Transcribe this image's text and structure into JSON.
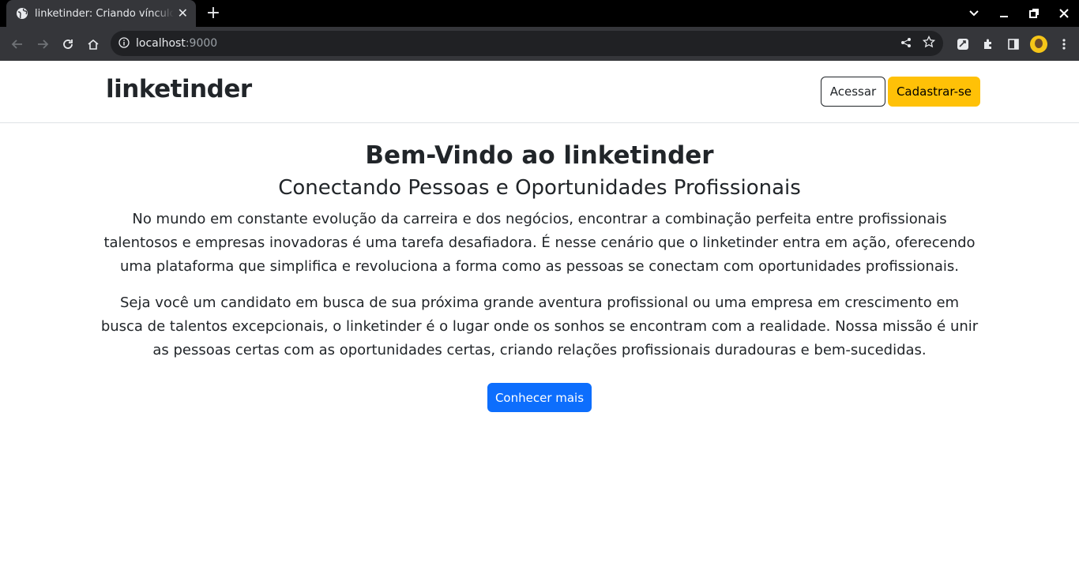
{
  "browser": {
    "tab_title": "linketinder: Criando vínculos",
    "url_host": "localhost",
    "url_port": ":9000"
  },
  "header": {
    "brand": "linketinder",
    "login_label": "Acessar",
    "signup_label": "Cadastrar-se"
  },
  "hero": {
    "title": "Bem-Vindo ao linketinder",
    "subtitle": "Conectando Pessoas e Oportunidades Profissionais",
    "paragraph1": "No mundo em constante evolução da carreira e dos negócios, encontrar a combinação perfeita entre profissionais talentosos e empresas inovadoras é uma tarefa desafiadora. É nesse cenário que o linketinder entra em ação, oferecendo uma plataforma que simplifica e revoluciona a forma como as pessoas se conectam com oportunidades profissionais.",
    "paragraph2": "Seja você um candidato em busca de sua próxima grande aventura profissional ou uma empresa em crescimento em busca de talentos excepcionais, o linketinder é o lugar onde os sonhos se encontram com a realidade. Nossa missão é unir as pessoas certas com as oportunidades certas, criando relações profissionais duradouras e bem-sucedidas.",
    "cta_label": "Conhecer mais"
  },
  "colors": {
    "primary": "#0d6efd",
    "warning": "#ffc107",
    "text": "#212529"
  }
}
